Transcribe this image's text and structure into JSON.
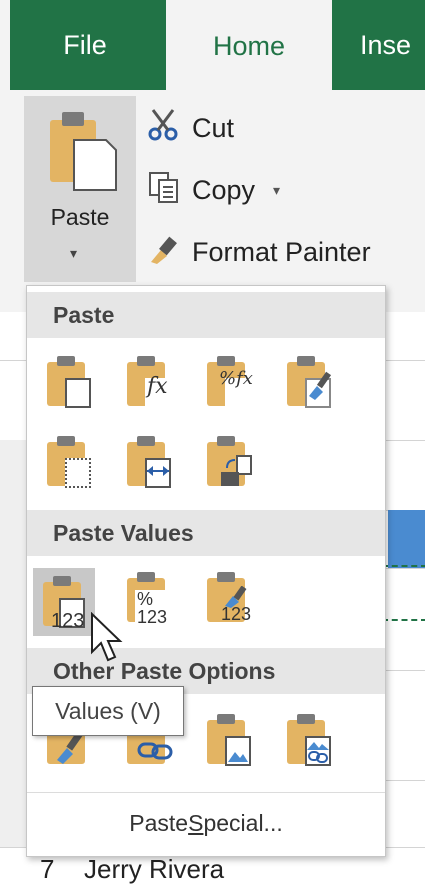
{
  "tabs": {
    "file": "File",
    "home": "Home",
    "insert": "Inse"
  },
  "clipboard": {
    "paste_label": "Paste",
    "paste_caret": "▾",
    "cut_label": "Cut",
    "copy_label": "Copy",
    "copy_caret": "▾",
    "format_painter_label": "Format Painter"
  },
  "paste_menu": {
    "section_paste": "Paste",
    "section_paste_values": "Paste Values",
    "section_other": "Other Paste Options",
    "paste_special_prefix": "Paste ",
    "paste_special_hotkey": "S",
    "paste_special_suffix": "pecial...",
    "value_icons": [
      "123",
      "%\n123",
      "123"
    ]
  },
  "tooltip": "Values (V)",
  "sheet": {
    "row_number": "7",
    "row_text": "Jerry Rivera"
  },
  "colors": {
    "accent": "#217346",
    "clipboard": "#e3b463",
    "selection": "#4a8bd0"
  }
}
